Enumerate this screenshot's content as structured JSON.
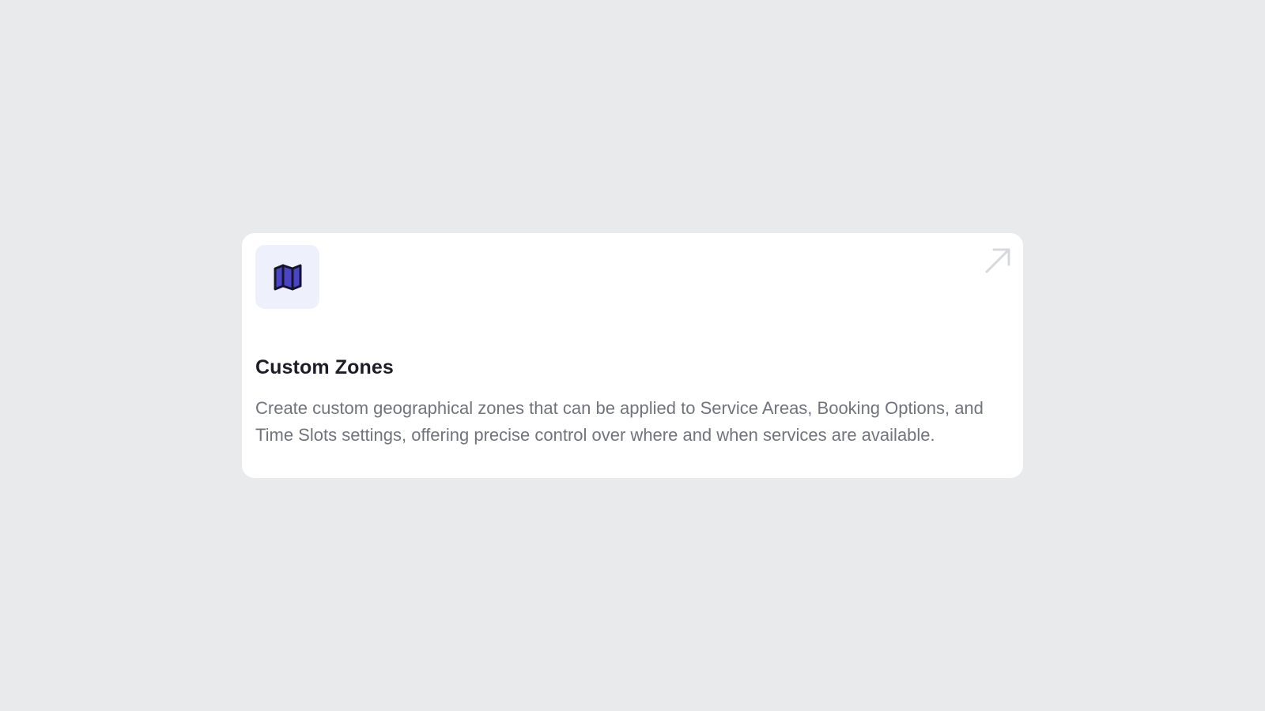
{
  "card": {
    "icon": "map-icon",
    "title": "Custom Zones",
    "description": "Create custom geographical zones that can be applied to Service Areas, Booking Options, and Time Slots settings, offering precise control over where and when services are available.",
    "link_icon": "arrow-up-right-icon"
  },
  "colors": {
    "page_background": "#e9eaec",
    "card_background": "#ffffff",
    "icon_tile_background": "#eef0fc",
    "icon_fill": "#4a45c4",
    "icon_stroke": "#16132e",
    "title": "#1d1d27",
    "description": "#71737d",
    "arrow": "#d6d8dd"
  }
}
